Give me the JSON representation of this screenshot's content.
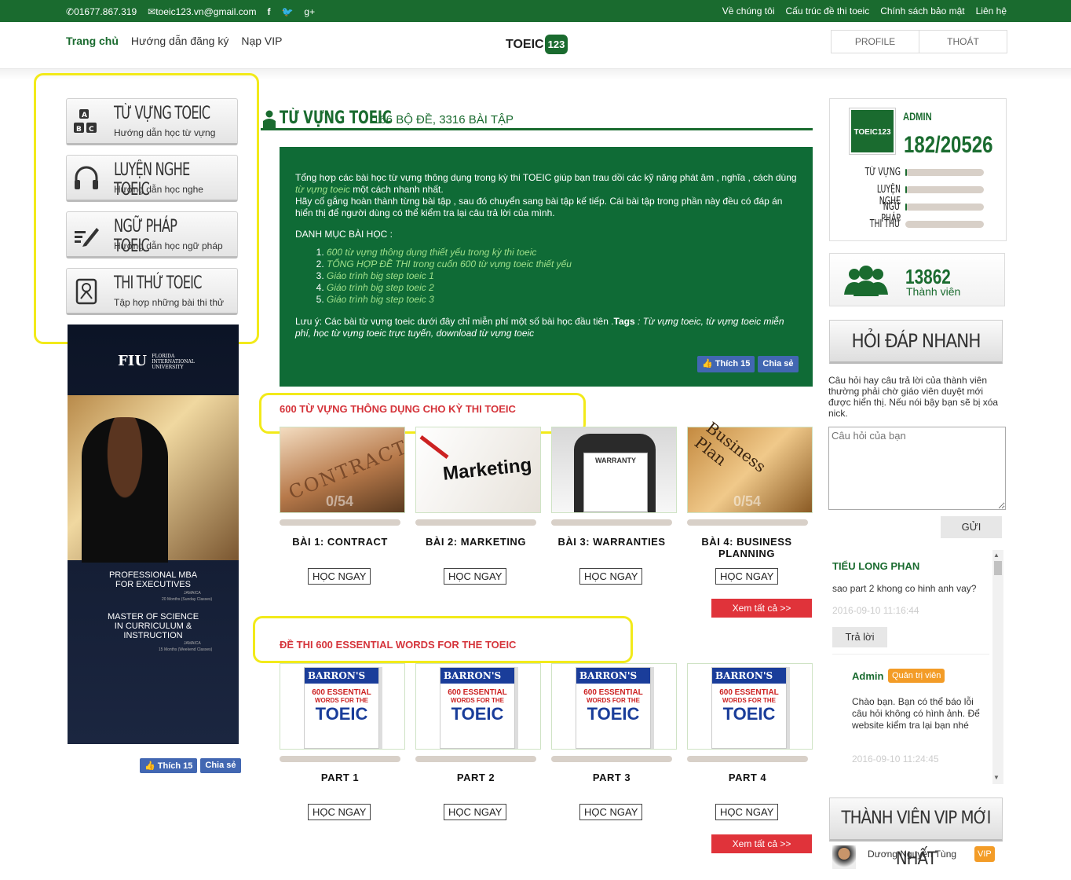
{
  "topbar": {
    "phone": "01677.867.319",
    "email": "toeic123.vn@gmail.com",
    "links": [
      "Về chúng tôi",
      "Cấu trúc đề thi toeic",
      "Chính sách bảo mật",
      "Liên hệ"
    ]
  },
  "nav": {
    "home": "Trang chủ",
    "guide": "Hướng dẫn đăng ký",
    "vip": "Nạp VIP",
    "logo_text": "TOEIC",
    "logo_num": "123",
    "profile": "PROFILE",
    "logout": "THOÁT"
  },
  "sidebar": [
    {
      "title": "TỪ VỰNG TOEIC",
      "sub": "Hướng dẫn học từ vựng",
      "icon": "abc-icon"
    },
    {
      "title": "LUYỆN NGHE TOEIC",
      "sub": "Hướng dẫn học nghe",
      "icon": "headphones-icon"
    },
    {
      "title": "NGỮ PHÁP TOEIC",
      "sub": "Hướng dẫn học ngữ pháp",
      "icon": "pencil-icon"
    },
    {
      "title": "THI THỬ TOEIC",
      "sub": "Tập hợp những bài thi thử",
      "icon": "exam-icon"
    }
  ],
  "ad": {
    "brand": "FIU",
    "brand_sub": "FLORIDA INTERNATIONAL UNIVERSITY",
    "line1": "PROFESSIONAL MBA",
    "line2": "FOR EXECUTIVES",
    "line1b": "JAMAICA",
    "line1c": "20 Months (Sunday Classes)",
    "line3": "MASTER OF SCIENCE",
    "line4": "IN CURRICULUM &",
    "line5": "INSTRUCTION",
    "line3b": "JAMAICA",
    "line3c": "15 Months (Weekend Classes)"
  },
  "social": {
    "like": "Thích 15",
    "share": "Chia sẻ"
  },
  "main": {
    "title": "TỪ VỰNG TOEIC",
    "count": "166 BỘ ĐỀ, 3316 BÀI TẬP",
    "intro1": "Tổng hợp các bài học từ vựng thông dụng trong kỳ thi TOEIC giúp bạn trau dồi các kỹ năng phát âm , nghĩa , cách dùng",
    "intro1_link": "từ vựng toeic",
    "intro1_end": "một cách nhanh nhất.",
    "intro2": "Hãy cố gắng hoàn thành từng bài tập , sau đó chuyển sang bài tập kế tiếp. Cái bài tập trong phần này đều có đáp án hiển thị để người dùng có thể kiểm tra lại câu trả lời của mình.",
    "cat_title": "DANH MỤC BÀI HỌC :",
    "cats": [
      "600 từ vựng thông dụng thiết yếu trong kỳ thi toeic",
      "TỔNG HỢP ĐỀ THI trong cuốn 600 từ vựng toeic thiết yếu",
      "Giáo trình big step toeic 1",
      "Giáo trình big step toeic 2",
      "Giáo trình big step toeic 3"
    ],
    "note_a": "Lưu ý: Các bài từ vựng toeic dưới đây chỉ miễn phí một số bài học đầu tiên .",
    "note_tags": "Tags",
    "note_b": ": Từ vựng toeic, từ vựng toeic miễn phí, học từ vựng toeic trực tuyến, download từ vựng toeic"
  },
  "sec1": {
    "title": "600 TỪ VỰNG THÔNG DỤNG CHO KỲ THI TOEIC",
    "more": "Xem tất cả >>",
    "items": [
      {
        "title": "BÀI 1: CONTRACT",
        "progress": "0/54",
        "img": "CONTRACT"
      },
      {
        "title": "BÀI 2: MARKETING",
        "progress": "",
        "img": "Marketing"
      },
      {
        "title": "BÀI 3: WARRANTIES",
        "progress": "",
        "img": "WARRANTY"
      },
      {
        "title": "BÀI 4: BUSINESS PLANNING",
        "progress": "0/54",
        "img": "Business Plan"
      }
    ],
    "btn": "HỌC NGAY"
  },
  "sec2": {
    "title": "ĐỀ THI 600 ESSENTIAL WORDS FOR THE TOEIC",
    "more": "Xem tất cả >>",
    "items": [
      {
        "title": "PART 1"
      },
      {
        "title": "PART 2"
      },
      {
        "title": "PART 3"
      },
      {
        "title": "PART 4"
      }
    ],
    "book": {
      "brand": "BARRON'S",
      "l1": "600 ESSENTIAL",
      "l2": "WORDS FOR THE",
      "l3": "TOEIC"
    },
    "btn": "HỌC NGAY"
  },
  "profile": {
    "name": "ADMIN",
    "score": "182/20526",
    "logo": "TOEIC123",
    "skills": [
      {
        "label": "TỪ VỰNG",
        "value": 0.02
      },
      {
        "label": "LUYỆN NGHE",
        "value": 0.02
      },
      {
        "label": "NGỮ PHÁP",
        "value": 0.02
      },
      {
        "label": "THI THỬ",
        "value": 0
      }
    ]
  },
  "members": {
    "count": "13862",
    "label": "Thành viên"
  },
  "qa": {
    "title": "HỎI ĐÁP NHANH",
    "desc": "Câu hỏi hay câu trả lời của thành viên thường phải chờ giáo viên duyệt mới được hiển thị. Nếu nói bậy bạn sẽ bị xóa nick.",
    "placeholder": "Câu hỏi của bạn",
    "send": "GỬI",
    "q_user": "TIỂU LONG PHAN",
    "q_text": "sao part 2 khong co hinh anh vay?",
    "q_time": "2016-09-10 11:16:44",
    "reply": "Trả lời",
    "a_user": "Admin",
    "a_badge": "Quản trị viên",
    "a_text": "Chào bạn. Bạn có thể báo lỗi câu hỏi không có hình ảnh. Để website kiểm tra lại bạn nhé",
    "a_time": "2016-09-10 11:24:45"
  },
  "vip": {
    "title": "THÀNH VIÊN VIP MỚI NHẤT",
    "user": "Dương Nguyễn Tùng",
    "badge": "VIP"
  },
  "colors": {
    "green": "#1a6b2f",
    "red": "#e0333a",
    "yellow_highlight": "#f2ea1a"
  }
}
